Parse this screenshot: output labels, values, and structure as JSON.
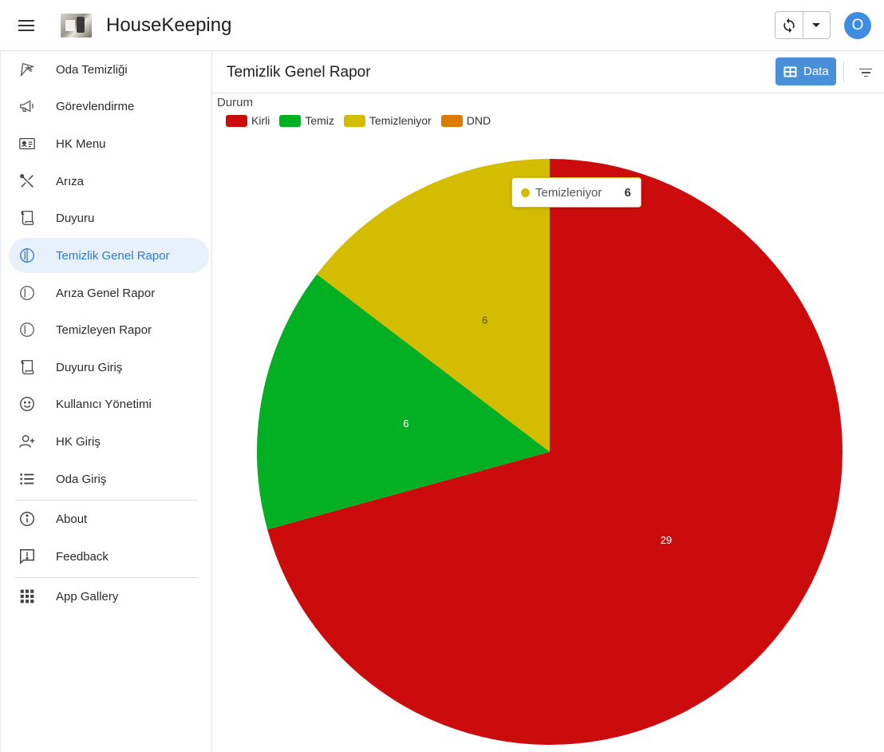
{
  "app": {
    "title": "HouseKeeping",
    "avatar_initial": "O"
  },
  "sidebar": {
    "items": [
      {
        "label": "Oda Temizliği",
        "icon": "broom-icon"
      },
      {
        "label": "Görevlendirme",
        "icon": "megaphone-icon"
      },
      {
        "label": "HK Menu",
        "icon": "id-card-icon"
      },
      {
        "label": "Arıza",
        "icon": "tools-icon"
      },
      {
        "label": "Duyuru",
        "icon": "scroll-icon"
      },
      {
        "label": "Temizlik Genel Rapor",
        "icon": "half-circle-icon",
        "active": true
      },
      {
        "label": "Arıza Genel Rapor",
        "icon": "half-circle-icon"
      },
      {
        "label": "Temizleyen Rapor",
        "icon": "half-circle-icon"
      },
      {
        "label": "Duyuru Giriş",
        "icon": "scroll-icon"
      },
      {
        "label": "Kullanıcı Yönetimi",
        "icon": "smiley-icon"
      },
      {
        "label": "HK Giriş",
        "icon": "person-add-icon"
      },
      {
        "label": "Oda Giriş",
        "icon": "list-icon"
      }
    ],
    "footer_items": [
      {
        "label": "About",
        "icon": "info-icon"
      },
      {
        "label": "Feedback",
        "icon": "feedback-icon"
      },
      {
        "label": "App Gallery",
        "icon": "grid-icon"
      }
    ]
  },
  "panel": {
    "title": "Temizlik Genel Rapor",
    "data_button_label": "Data"
  },
  "tooltip": {
    "label": "Temizleniyor",
    "value": "6",
    "color": "#d4bc00"
  },
  "chart_data": {
    "type": "pie",
    "legend_title": "Durum",
    "legend_position": "top-left",
    "slices": [
      {
        "name": "Kirli",
        "value": 29,
        "color": "#cc0c0c"
      },
      {
        "name": "Temiz",
        "value": 6,
        "color": "#03b024"
      },
      {
        "name": "Temizleniyor",
        "value": 6,
        "color": "#d4bc00"
      },
      {
        "name": "DND",
        "value": 0,
        "color": "#dd7a02"
      }
    ]
  }
}
